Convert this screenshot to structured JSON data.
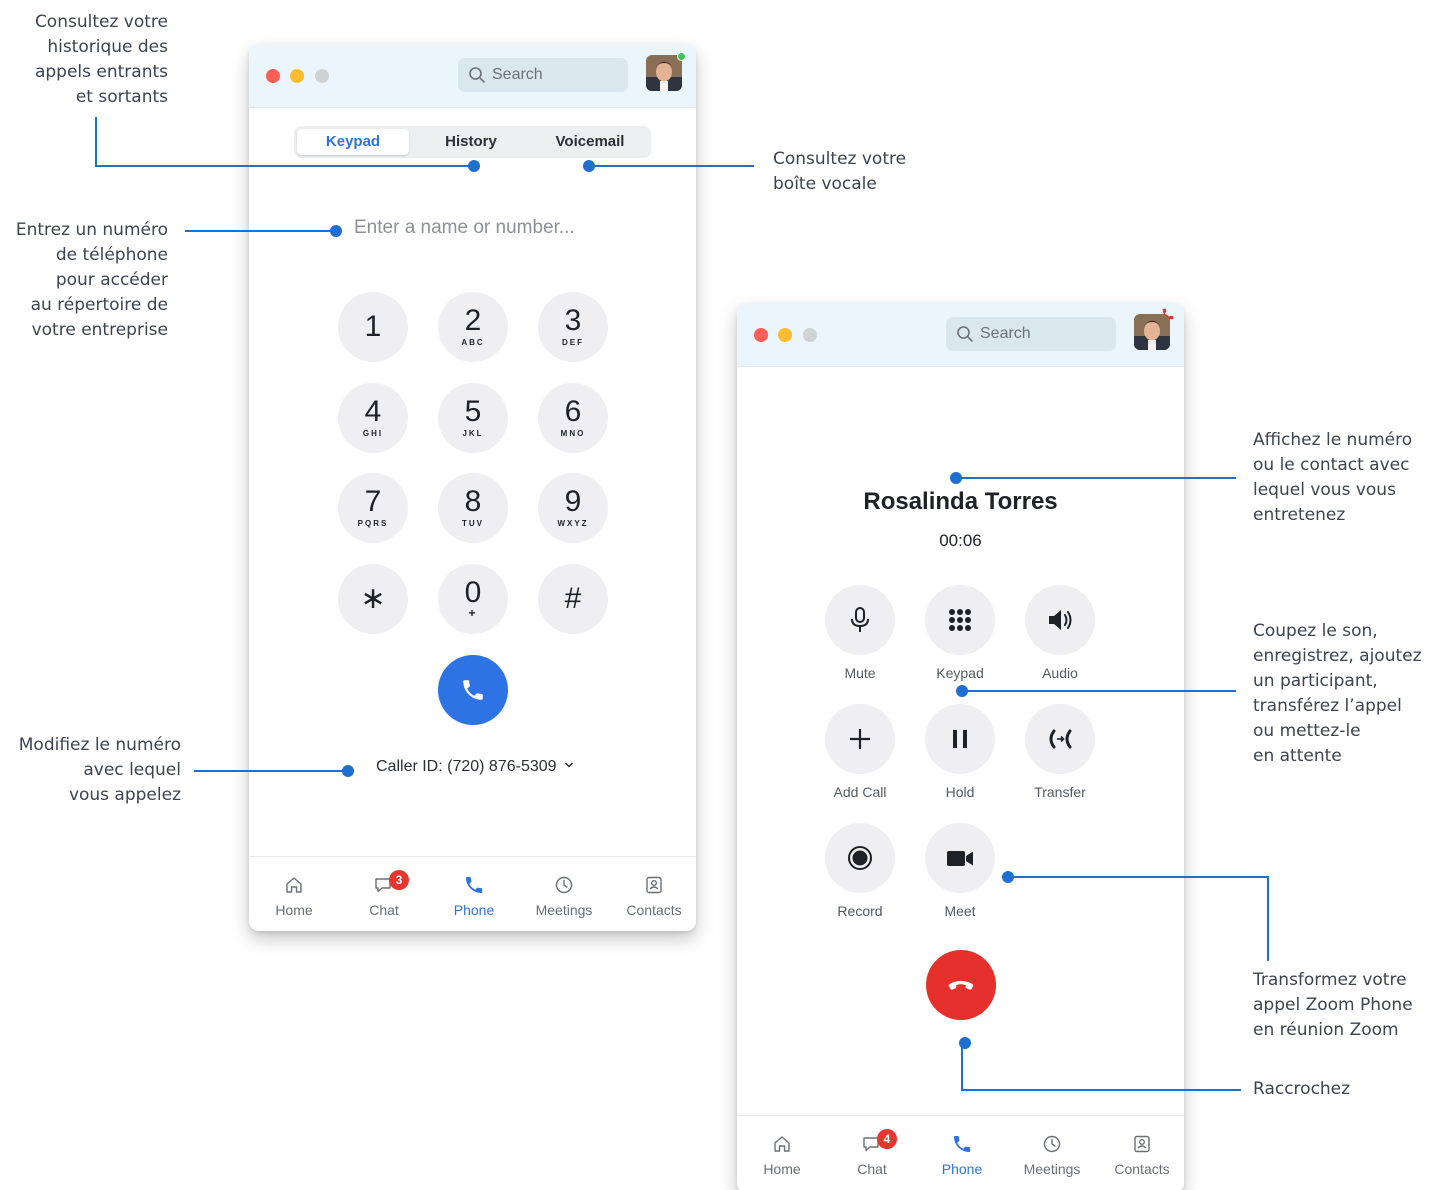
{
  "colors": {
    "accent": "#2d73e4",
    "annotation_line": "#1d6fd0",
    "hangup": "#e5302c",
    "badge": "#e8352e"
  },
  "annotations": {
    "history": "Consultez votre\nhistorique des\nappels entrants\net sortants",
    "voicemail": "Consultez votre\nboîte vocale",
    "enter_number": "Entrez un numéro\nde téléphone\npour accéder\nau répertoire de\nvotre entreprise",
    "caller_id": "Modifiez le numéro\navec lequel\nvous appelez",
    "contact": "Affichez le numéro\nou le contact avec\nlequel vous vous\nentretenez",
    "controls": "Coupez le son,\nenregistrez, ajoutez\nun participant,\ntransférez l’appel\nou mettez-le\nen attente",
    "meet": "Transformez votre\nappel Zoom Phone\nen réunion Zoom",
    "hangup": "Raccrochez"
  },
  "dialer_window": {
    "search_placeholder": "Search",
    "tabs": [
      "Keypad",
      "History",
      "Voicemail"
    ],
    "active_tab": "Keypad",
    "input_placeholder": "Enter a name or number...",
    "keys": [
      {
        "digit": "1",
        "letters": ""
      },
      {
        "digit": "2",
        "letters": "ABC"
      },
      {
        "digit": "3",
        "letters": "DEF"
      },
      {
        "digit": "4",
        "letters": "GHI"
      },
      {
        "digit": "5",
        "letters": "JKL"
      },
      {
        "digit": "6",
        "letters": "MNO"
      },
      {
        "digit": "7",
        "letters": "PQRS"
      },
      {
        "digit": "8",
        "letters": "TUV"
      },
      {
        "digit": "9",
        "letters": "WXYZ"
      },
      {
        "digit": "∗",
        "letters": ""
      },
      {
        "digit": "0",
        "letters": "+"
      },
      {
        "digit": "#",
        "letters": ""
      }
    ],
    "caller_id": "Caller ID: (720) 876-5309",
    "tabbar": [
      {
        "label": "Home",
        "icon": "home-icon"
      },
      {
        "label": "Chat",
        "icon": "chat-icon",
        "badge": "3"
      },
      {
        "label": "Phone",
        "icon": "phone-icon"
      },
      {
        "label": "Meetings",
        "icon": "clock-icon"
      },
      {
        "label": "Contacts",
        "icon": "contacts-icon"
      }
    ],
    "active_nav": "Phone"
  },
  "call_window": {
    "search_placeholder": "Search",
    "contact_name": "Rosalinda Torres",
    "duration": "00:06",
    "controls": [
      {
        "label": "Mute",
        "icon": "microphone-icon"
      },
      {
        "label": "Keypad",
        "icon": "keypad-icon"
      },
      {
        "label": "Audio",
        "icon": "speaker-icon"
      },
      {
        "label": "Add Call",
        "icon": "plus-icon"
      },
      {
        "label": "Hold",
        "icon": "pause-icon"
      },
      {
        "label": "Transfer",
        "icon": "transfer-icon"
      },
      {
        "label": "Record",
        "icon": "record-icon"
      },
      {
        "label": "Meet",
        "icon": "video-camera-icon"
      }
    ],
    "tabbar": [
      {
        "label": "Home",
        "icon": "home-icon"
      },
      {
        "label": "Chat",
        "icon": "chat-icon",
        "badge": "4"
      },
      {
        "label": "Phone",
        "icon": "phone-icon"
      },
      {
        "label": "Meetings",
        "icon": "clock-icon"
      },
      {
        "label": "Contacts",
        "icon": "contacts-icon"
      }
    ],
    "active_nav": "Phone"
  }
}
